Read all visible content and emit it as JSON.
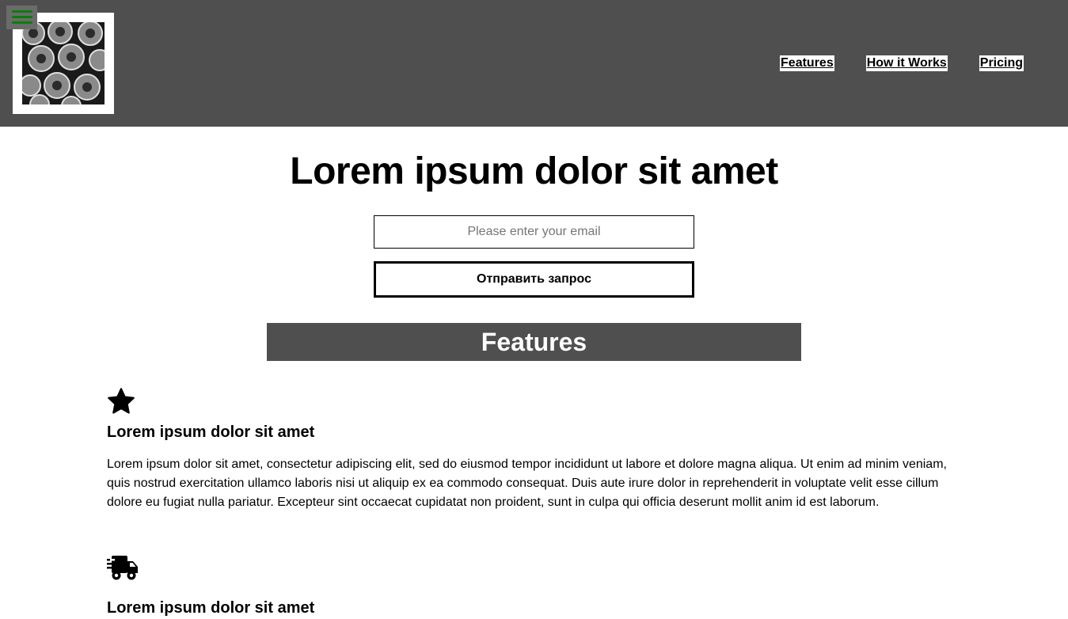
{
  "header": {
    "logo_icon": "pomegranate-photo-icon",
    "menu_icon": "hamburger-menu-icon",
    "nav": [
      {
        "label": "Features"
      },
      {
        "label": "How it Works"
      },
      {
        "label": "Pricing"
      }
    ]
  },
  "hero": {
    "title": "Lorem ipsum dolor sit amet",
    "email_placeholder": "Please enter your email",
    "submit_label": "Отправить запрос"
  },
  "features": {
    "heading": "Features",
    "items": [
      {
        "icon": "star-icon",
        "title": "Lorem ipsum dolor sit amet",
        "text": "Lorem ipsum dolor sit amet, consectetur adipiscing elit, sed do eiusmod tempor incididunt ut labore et dolore magna aliqua. Ut enim ad minim veniam, quis nostrud exercitation ullamco laboris nisi ut aliquip ex ea commodo consequat. Duis aute irure dolor in reprehenderit in voluptate velit esse cillum dolore eu fugiat nulla pariatur. Excepteur sint occaecat cupidatat non proident, sunt in culpa qui officia deserunt mollit anim id est laborum."
      },
      {
        "icon": "fast-delivery-truck-icon",
        "title": "Lorem ipsum dolor sit amet"
      }
    ]
  },
  "colors": {
    "header_bg": "#4f4f4f",
    "menu_accent": "#0a7d0a"
  }
}
